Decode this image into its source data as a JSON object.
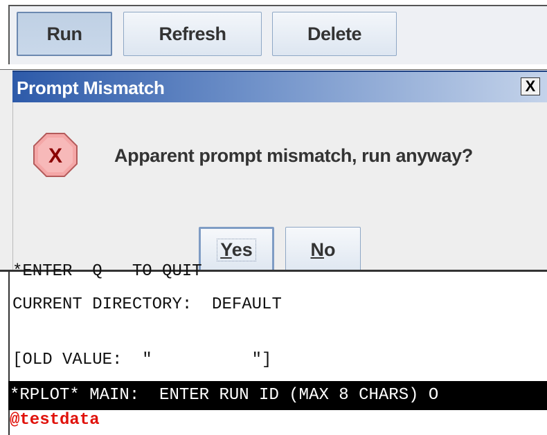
{
  "toolbar": {
    "run_label": "Run",
    "refresh_label": "Refresh",
    "delete_label": "Delete"
  },
  "dialog": {
    "title": "Prompt Mismatch",
    "close_glyph": "X",
    "icon": "error-x-icon",
    "message": "Apparent prompt mismatch, run anyway?",
    "yes_mnemonic": "Y",
    "yes_rest": "es",
    "no_mnemonic": "N",
    "no_rest": "o"
  },
  "console": {
    "line_cut": "*ENTER  Q   TO QUIT",
    "line_dir": "CURRENT DIRECTORY:  DEFAULT",
    "line_old": "[OLD VALUE:  \"          \"]",
    "prompt_bar": "*RPLOT* MAIN:  ENTER RUN ID (MAX 8 CHARS) O",
    "input": "@testdata"
  },
  "colors": {
    "title_gradient_start": "#2d5aa9",
    "error_icon_fill": "#f0a0a0",
    "input_text": "#e0120b",
    "prompt_bar_bg": "#000000"
  }
}
